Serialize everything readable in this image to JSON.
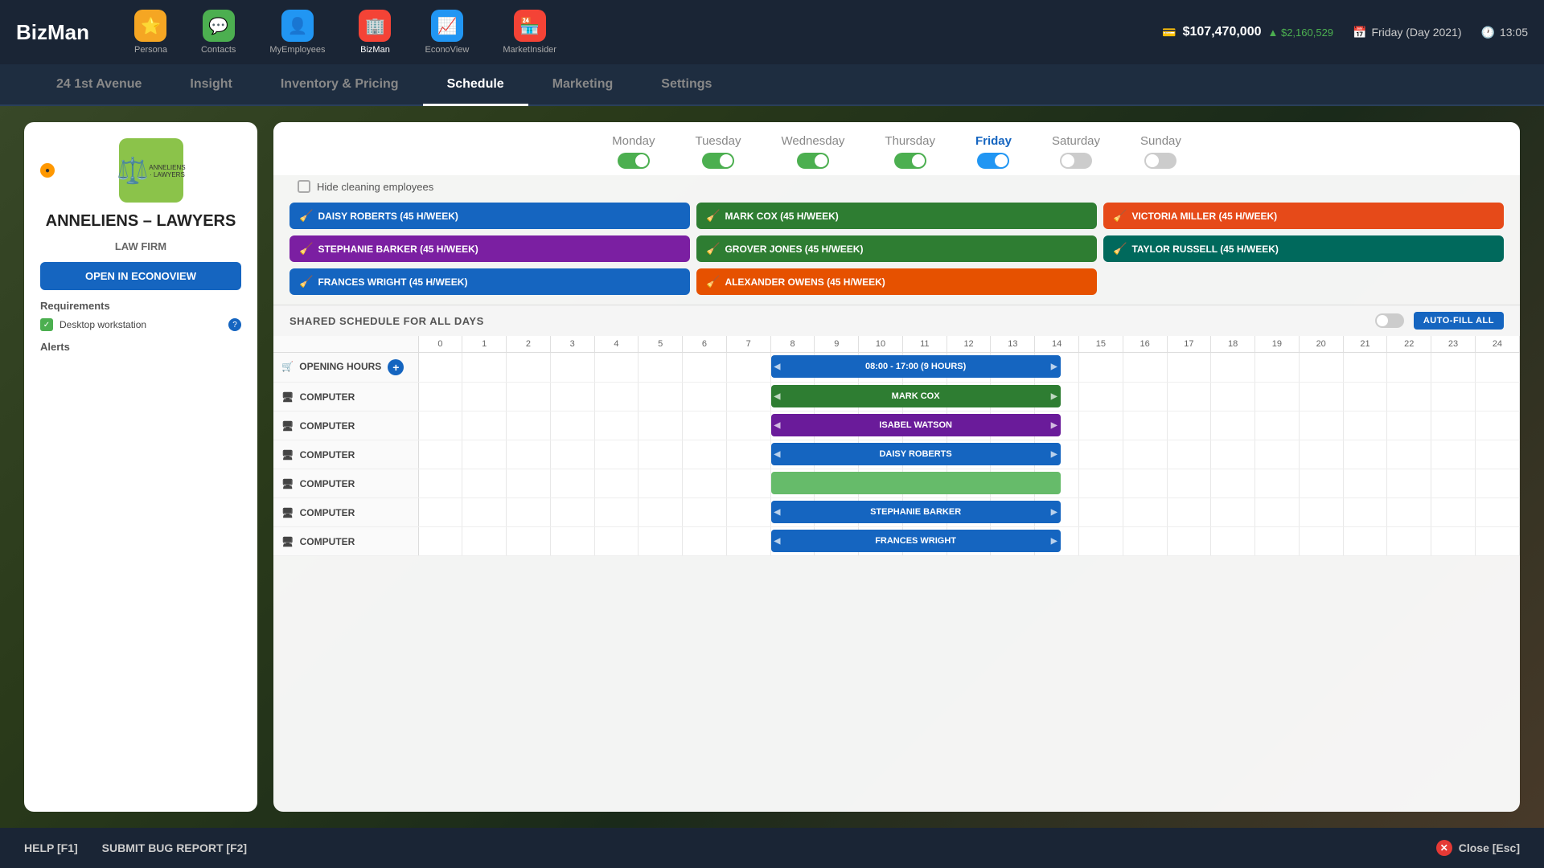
{
  "app": {
    "logo": "BizMan"
  },
  "nav": {
    "items": [
      {
        "id": "persona",
        "label": "Persona",
        "icon": "⭐",
        "iconClass": "persona"
      },
      {
        "id": "contacts",
        "label": "Contacts",
        "icon": "💬",
        "iconClass": "contacts"
      },
      {
        "id": "myemployees",
        "label": "MyEmployees",
        "icon": "👤",
        "iconClass": "myemployees"
      },
      {
        "id": "bizman",
        "label": "BizMan",
        "icon": "🏢",
        "iconClass": "bizman",
        "active": true
      },
      {
        "id": "econoview",
        "label": "EconoView",
        "icon": "📈",
        "iconClass": "econoview"
      },
      {
        "id": "marketinsider",
        "label": "MarketInsider",
        "icon": "🏪",
        "iconClass": "marketinsider"
      }
    ]
  },
  "header": {
    "money": "$107,470,000",
    "change": "▲ $2,160,529",
    "date": "Friday (Day 2021)",
    "time": "13:05"
  },
  "secondary_nav": {
    "items": [
      {
        "label": "24 1st Avenue"
      },
      {
        "label": "Insight"
      },
      {
        "label": "Inventory & Pricing"
      },
      {
        "label": "Schedule",
        "active": true
      },
      {
        "label": "Marketing"
      },
      {
        "label": "Settings"
      }
    ]
  },
  "company": {
    "name": "ANNELIENS – LAWYERS",
    "type": "LAW FIRM",
    "btn_label": "OPEN IN ECONOVIEW",
    "requirement": "Desktop workstation",
    "requirements_title": "Requirements",
    "alerts_title": "Alerts"
  },
  "schedule": {
    "days": [
      {
        "label": "Monday",
        "state": "on"
      },
      {
        "label": "Tuesday",
        "state": "on"
      },
      {
        "label": "Wednesday",
        "state": "on"
      },
      {
        "label": "Thursday",
        "state": "on"
      },
      {
        "label": "Friday",
        "state": "on-blue",
        "active": true
      },
      {
        "label": "Saturday",
        "state": "off"
      },
      {
        "label": "Sunday",
        "state": "off"
      }
    ],
    "hide_cleaning_label": "Hide cleaning employees",
    "employees": [
      {
        "name": "DAISY ROBERTS (45 H/WEEK)",
        "color": "blue"
      },
      {
        "name": "MARK COX (45 H/WEEK)",
        "color": "green-dark"
      },
      {
        "name": "VICTORIA MILLER (45 H/WEEK)",
        "color": "red-orange"
      },
      {
        "name": "STEPHANIE BARKER (45 H/WEEK)",
        "color": "purple"
      },
      {
        "name": "GROVER JONES (45 H/WEEK)",
        "color": "green-dark"
      },
      {
        "name": "TAYLOR RUSSELL (45 H/WEEK)",
        "color": "teal"
      },
      {
        "name": "FRANCES WRIGHT (45 H/WEEK)",
        "color": "blue"
      },
      {
        "name": "ALEXANDER OWENS (45 H/WEEK)",
        "color": "orange"
      }
    ],
    "shared_label": "SHARED SCHEDULE FOR ALL DAYS",
    "auto_fill_label": "AUTO-FILL ALL",
    "hours": [
      "0",
      "1",
      "2",
      "3",
      "4",
      "5",
      "6",
      "7",
      "8",
      "9",
      "10",
      "11",
      "12",
      "13",
      "14",
      "15",
      "16",
      "17",
      "18",
      "19",
      "20",
      "21",
      "22",
      "23",
      "24"
    ],
    "rows": [
      {
        "label": "OPENING HOURS",
        "icon": "🛒",
        "event": {
          "label": "08:00 - 17:00 (9 HOURS)",
          "color": "blue-bar",
          "start": 8,
          "end": 17
        }
      },
      {
        "label": "COMPUTER",
        "icon": "🖥",
        "event": {
          "label": "MARK COX",
          "color": "green-bar",
          "start": 8,
          "end": 17
        }
      },
      {
        "label": "COMPUTER",
        "icon": "🖥",
        "event": {
          "label": "ISABEL WATSON",
          "color": "purple-bar",
          "start": 8,
          "end": 17
        }
      },
      {
        "label": "COMPUTER",
        "icon": "🖥",
        "event": {
          "label": "DAISY ROBERTS",
          "color": "blue-bar",
          "start": 8,
          "end": 17
        }
      },
      {
        "label": "COMPUTER",
        "icon": "🖥",
        "event": {
          "label": "",
          "color": "light-green-bar",
          "start": 8,
          "end": 17
        }
      },
      {
        "label": "COMPUTER",
        "icon": "🖥",
        "event": {
          "label": "STEPHANIE BARKER",
          "color": "blue-bar",
          "start": 8,
          "end": 17
        }
      },
      {
        "label": "COMPUTER",
        "icon": "🖥",
        "event": {
          "label": "FRANCES WRIGHT",
          "color": "blue-bar",
          "start": 8,
          "end": 17
        }
      }
    ]
  },
  "bottom": {
    "help": "HELP [F1]",
    "bug": "SUBMIT BUG REPORT [F2]",
    "close": "Close [Esc]"
  }
}
